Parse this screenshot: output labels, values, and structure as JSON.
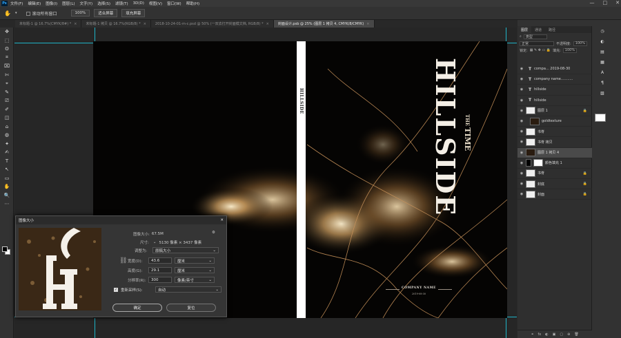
{
  "app": {
    "logo": "Ps",
    "menus": [
      "文件(F)",
      "编辑(E)",
      "图像(I)",
      "图层(L)",
      "文字(Y)",
      "选择(S)",
      "滤镜(T)",
      "3D(D)",
      "视图(V)",
      "窗口(W)",
      "帮助(H)"
    ],
    "window_controls": [
      "—",
      "□",
      "✕"
    ]
  },
  "options_bar": {
    "scroll_all_label": "滚动所有窗口",
    "zoom_value": "100%",
    "fit_screen_label": "适合屏幕",
    "fill_screen_label": "填充屏幕"
  },
  "tabs": [
    {
      "label": "未标题-1 @ 16.7%(CMYK/8#) *",
      "active": false
    },
    {
      "label": "未标题-1 拷贝 @ 16.7%(RGB/8) *",
      "active": false
    },
    {
      "label": "2018-10-24-01-m-c.psd @ 50% (一双去打开封面模文档, RGB/8) *",
      "active": false
    },
    {
      "label": "封面设计.psb @ 25% (图层 1 拷贝 4, CMYK/8/CMYK)",
      "active": true
    }
  ],
  "tools": [
    "✥",
    "⬚",
    "ʘ",
    "⌗",
    "⌧",
    "✄",
    "⌖",
    "✎",
    "⎚",
    "✐",
    "◫",
    "⌂",
    "◍",
    "✦",
    "✍",
    "T",
    "↖",
    "▭",
    "✋",
    "🔍",
    "⋯"
  ],
  "document": {
    "spine_title": "HILLSIDE",
    "front_title": "HILLSIDE",
    "front_the": "THE",
    "front_time": "TIME",
    "company": "COMPANY NAME",
    "date": "2019-08-30"
  },
  "layers_panel": {
    "tabs": [
      "图层",
      "通道",
      "路径"
    ],
    "search_placeholder": "类型",
    "blend_mode": "正常",
    "opacity_label": "不透明度:",
    "opacity_value": "100%",
    "lock_label": "锁定:",
    "fill_label": "填充:",
    "fill_value": "100%",
    "layers": [
      {
        "name": "compa... 2019-08-30",
        "kind": "text",
        "locked": false,
        "selected": false
      },
      {
        "name": "company name...........",
        "kind": "text",
        "locked": false,
        "selected": false
      },
      {
        "name": "hillside",
        "kind": "text",
        "locked": false,
        "selected": false
      },
      {
        "name": "hillside",
        "kind": "text",
        "locked": false,
        "selected": false
      },
      {
        "name": "图层 1",
        "kind": "image",
        "locked": true,
        "selected": false
      },
      {
        "name": "goldtexture",
        "kind": "image-dark",
        "locked": false,
        "selected": false
      },
      {
        "name": "书脊",
        "kind": "image",
        "locked": false,
        "selected": false
      },
      {
        "name": "书脊 拷贝",
        "kind": "image",
        "locked": false,
        "selected": false
      },
      {
        "name": "图层 1 拷贝 4",
        "kind": "image-dark",
        "locked": false,
        "selected": true
      },
      {
        "name": "颜色填充 1",
        "kind": "fill",
        "locked": false,
        "selected": false
      },
      {
        "name": "书脊",
        "kind": "image",
        "locked": true,
        "selected": false
      },
      {
        "name": "封底",
        "kind": "image",
        "locked": true,
        "selected": false
      },
      {
        "name": "封面",
        "kind": "image",
        "locked": true,
        "selected": false
      }
    ],
    "footer_icons": [
      "fx",
      "◐",
      "▣",
      "▢",
      "⊕",
      "🗑"
    ]
  },
  "image_size_dialog": {
    "title": "图像大小",
    "image_size_label": "图像大小:",
    "image_size_value": "67.5M",
    "dimensions_label": "尺寸:",
    "dimensions_value": "5130 像素 × 3437 像素",
    "fit_to_label": "调整为:",
    "fit_to_value": "原稿大小",
    "width_label": "宽度(D):",
    "width_value": "43.6",
    "width_unit": "厘米",
    "height_label": "高度(G):",
    "height_value": "29.1",
    "height_unit": "厘米",
    "resolution_label": "分辨率(R):",
    "resolution_value": "300",
    "resolution_unit": "像素/英寸",
    "resample_label": "重新采样(S):",
    "resample_value": "自动",
    "ok_label": "确定",
    "cancel_label": "复位"
  },
  "colors": {
    "guide": "#1fb6c9",
    "accent_blue": "#31a8ff"
  }
}
